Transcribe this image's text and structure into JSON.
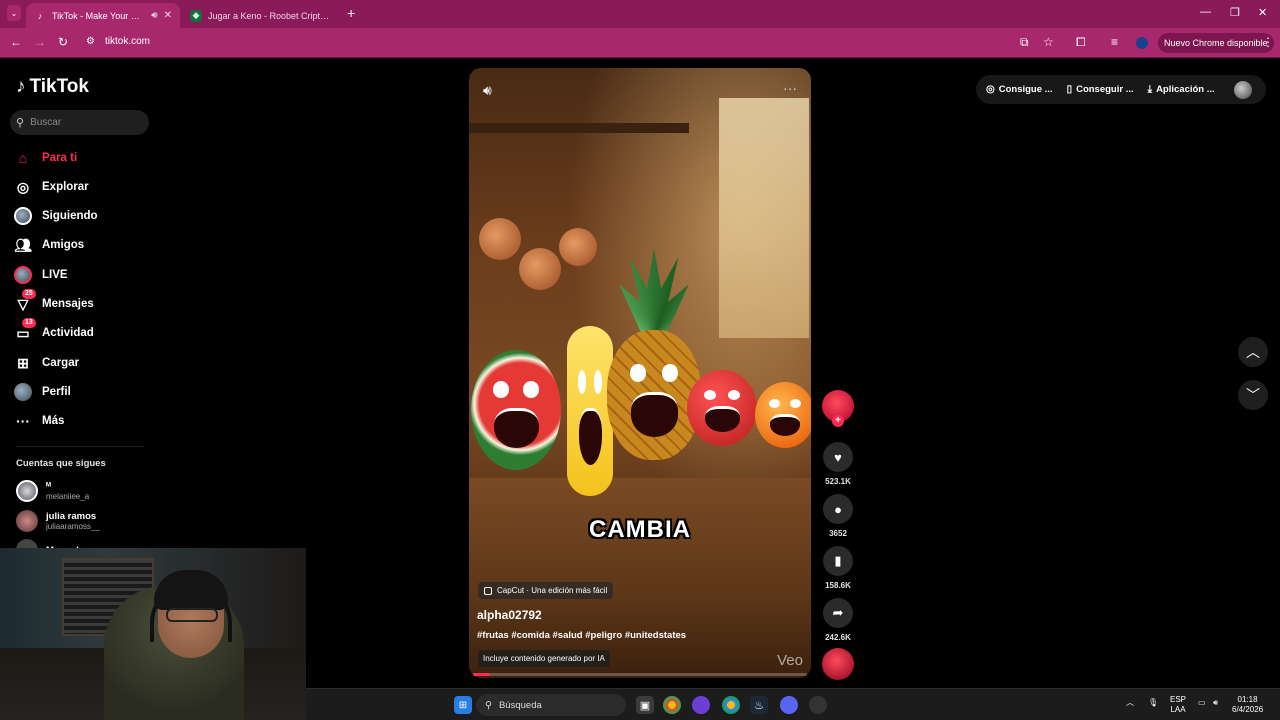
{
  "browser": {
    "tabs": [
      {
        "title": "TikTok - Make Your Day",
        "active": true
      },
      {
        "title": "Jugar a Keno - Roobet Cripto C",
        "active": false
      }
    ],
    "url": "tiktok.com",
    "update_label": "Nuevo Chrome disponible",
    "accent_color": "#a8286e"
  },
  "tiktok": {
    "logo": "TikTok",
    "search_placeholder": "Buscar",
    "nav": [
      {
        "label": "Para ti",
        "icon": "home-icon",
        "active": true
      },
      {
        "label": "Explorar",
        "icon": "compass-icon"
      },
      {
        "label": "Siguiendo",
        "icon": "following-avatar-icon"
      },
      {
        "label": "Amigos",
        "icon": "friends-icon"
      },
      {
        "label": "LIVE",
        "icon": "live-icon"
      },
      {
        "label": "Mensajes",
        "icon": "messages-icon",
        "badge": "25"
      },
      {
        "label": "Actividad",
        "icon": "activity-icon",
        "badge": "13"
      },
      {
        "label": "Cargar",
        "icon": "upload-icon"
      },
      {
        "label": "Perfil",
        "icon": "profile-icon"
      },
      {
        "label": "Más",
        "icon": "more-icon"
      }
    ],
    "following_title": "Cuentas que sigues",
    "following": [
      {
        "name": "ᴹ",
        "handle": "melaniiee_a"
      },
      {
        "name": "julia ramos",
        "handle": "juliaaramoss__"
      },
      {
        "name": "Manuel",
        "handle": ""
      }
    ],
    "top_pills": [
      {
        "label": "Consigue ...",
        "icon": "coin-icon"
      },
      {
        "label": "Conseguir ...",
        "icon": "phone-icon"
      },
      {
        "label": "Aplicación ...",
        "icon": "download-icon"
      }
    ],
    "brand_color": "#fe2c55"
  },
  "video": {
    "overlay_text": "CAMBIA",
    "capcut_tag": "CapCut · Una edición más fácil",
    "author": "alpha02792",
    "description": "#frutas #comida #salud #peligro #unitedstates",
    "ai_label": "Incluye contenido generado por IA",
    "watermark": "Veo",
    "progress": 0.05
  },
  "actions": {
    "likes": "523.1K",
    "comments": "3652",
    "saves": "158.6K",
    "shares": "242.6K"
  },
  "taskbar": {
    "search_label": "Búsqueda",
    "lang_top": "ESP",
    "lang_bottom": "LAA",
    "time": "01:18",
    "date": "6/4/2026"
  }
}
